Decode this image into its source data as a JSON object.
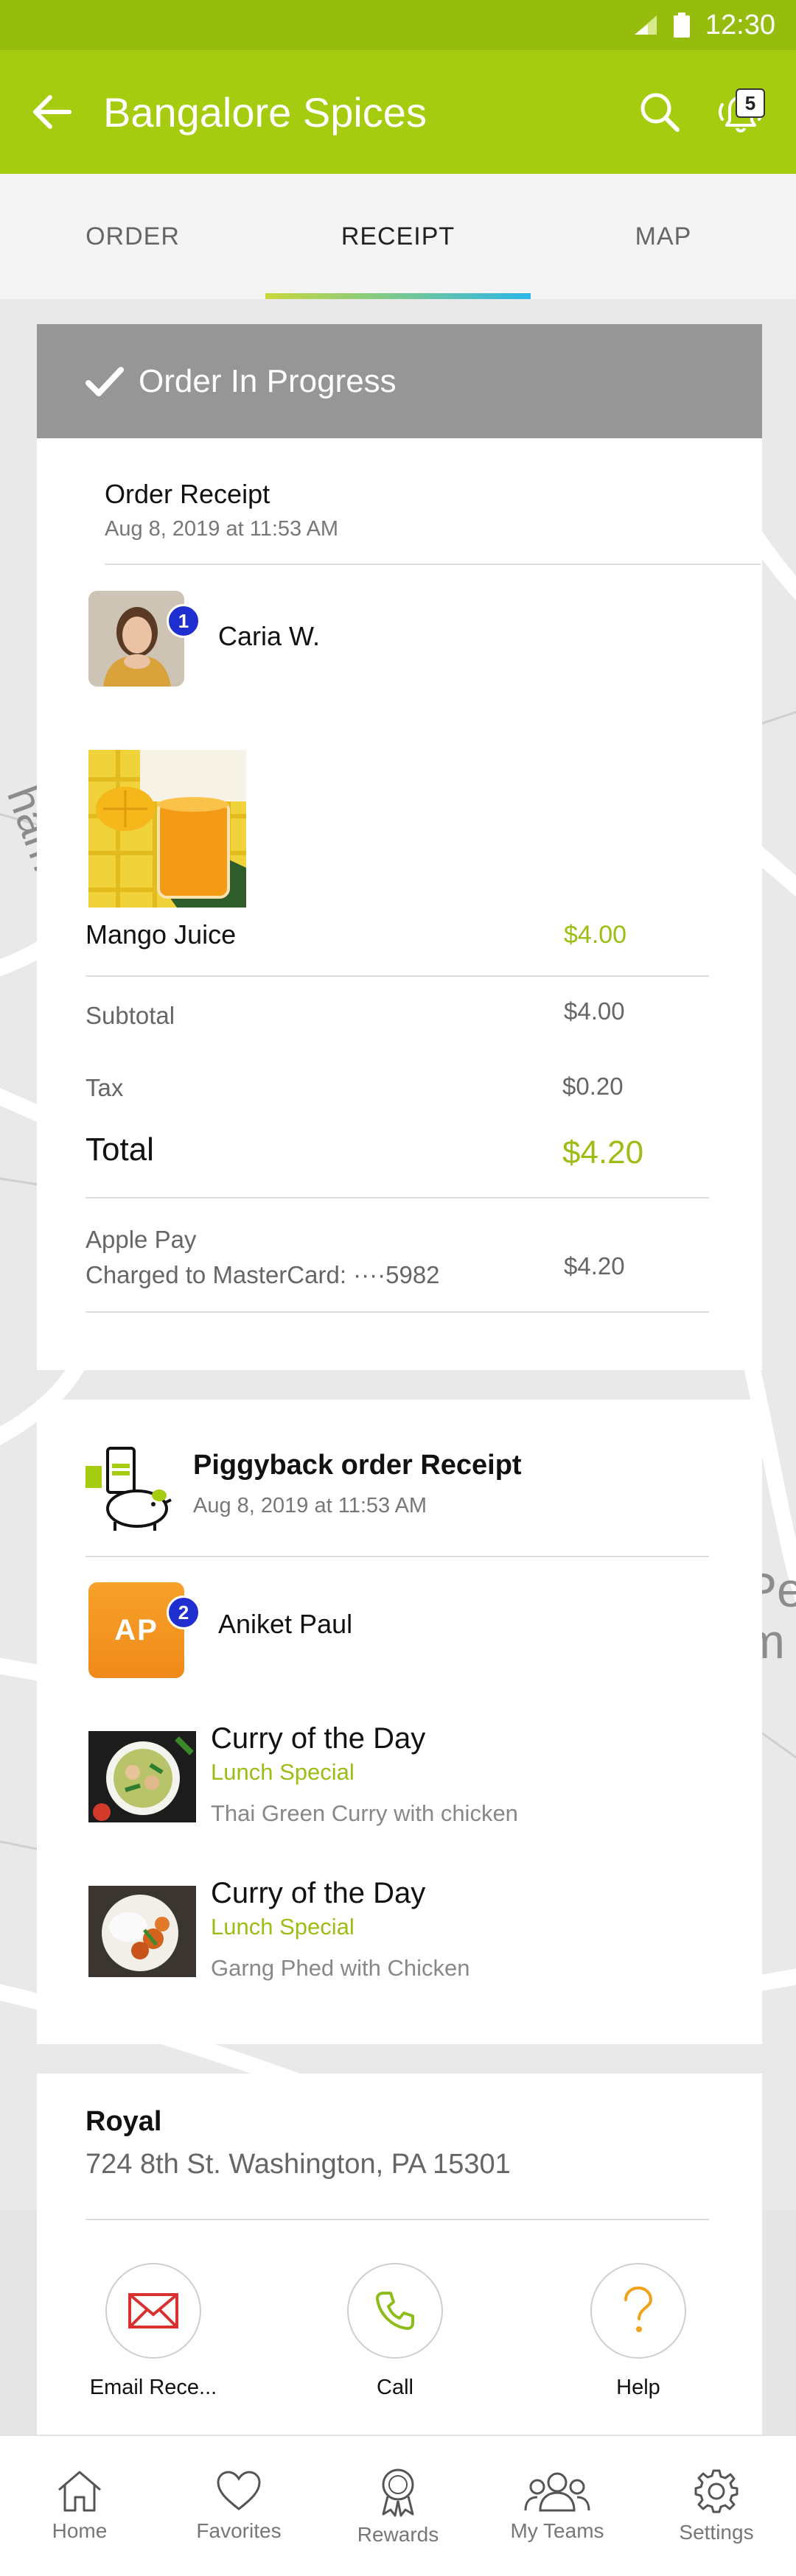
{
  "status_bar": {
    "time": "12:30"
  },
  "app_bar": {
    "title": "Bangalore Spices",
    "notification_count": "5"
  },
  "tabs": [
    {
      "label": "ORDER"
    },
    {
      "label": "RECEIPT",
      "active": true
    },
    {
      "label": "MAP"
    }
  ],
  "order_card": {
    "status": "Order In Progress",
    "receipt_title": "Order Receipt",
    "receipt_date": "Aug 8, 2019 at 11:53 AM",
    "person": {
      "name": "Caria W.",
      "badge": "1"
    },
    "item": {
      "name": "Mango Juice",
      "price": "$4.00"
    },
    "subtotal": {
      "label": "Subtotal",
      "value": "$4.00"
    },
    "tax": {
      "label": "Tax",
      "value": "$0.20"
    },
    "total": {
      "label": "Total",
      "value": "$4.20"
    },
    "payment": {
      "method": "Apple Pay",
      "charged": "Charged to MasterCard: ····5982",
      "value": "$4.20"
    }
  },
  "piggyback_card": {
    "title": "Piggyback order Receipt",
    "date": "Aug 8, 2019 at 11:53 AM",
    "person": {
      "initials": "AP",
      "name": "Aniket Paul",
      "badge": "2"
    },
    "items": [
      {
        "title": "Curry of the Day",
        "subtitle": "Lunch Special",
        "description": "Thai Green Curry with chicken"
      },
      {
        "title": "Curry of the Day",
        "subtitle": "Lunch Special",
        "description": "Garng Phed with Chicken"
      }
    ]
  },
  "restaurant_card": {
    "name": "Royal",
    "address": "724 8th St. Washington, PA 15301",
    "actions": [
      {
        "label": "Email Rece...",
        "icon": "envelope-icon"
      },
      {
        "label": "Call",
        "icon": "phone-icon"
      },
      {
        "label": "Help",
        "icon": "question-icon"
      }
    ]
  },
  "bottom_nav": [
    {
      "label": "Home",
      "icon": "home-icon"
    },
    {
      "label": "Favorites",
      "icon": "heart-icon"
    },
    {
      "label": "Rewards",
      "icon": "award-icon"
    },
    {
      "label": "My Teams",
      "icon": "teams-icon"
    },
    {
      "label": "Settings",
      "icon": "gear-icon"
    }
  ],
  "colors": {
    "primary": "#a6cc10",
    "accent_green": "#9cbd14",
    "badge_blue": "#1f2fcf",
    "header_gray": "#969696"
  }
}
